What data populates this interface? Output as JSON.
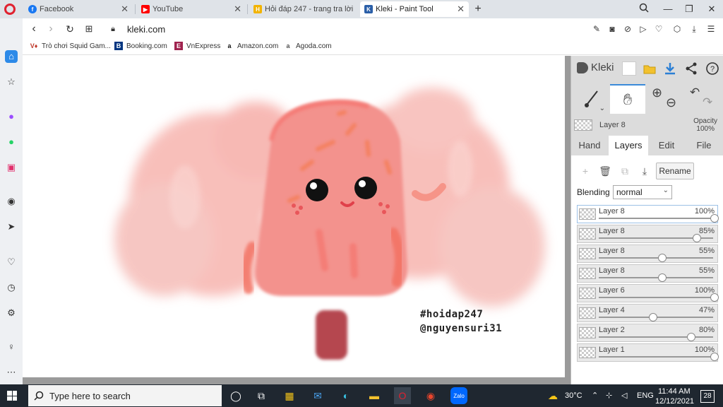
{
  "browser": {
    "tabs": [
      {
        "label": "Facebook",
        "favicon_color": "#1877f2",
        "favicon_text": "f"
      },
      {
        "label": "YouTube",
        "favicon_color": "#ff0000",
        "favicon_text": "▶"
      },
      {
        "label": "Hỏi đáp 247 - trang tra lời",
        "favicon_color": "#f2b300",
        "favicon_text": "H"
      },
      {
        "label": "Kleki - Paint Tool",
        "favicon_color": "#2b5fa8",
        "favicon_text": "K"
      }
    ],
    "new_tab": "+",
    "url": "kleki.com",
    "bookmarks": [
      {
        "label": "Trò chơi Squid Gam...",
        "icon": "V♦",
        "icon_color": "#c0392b"
      },
      {
        "label": "Booking.com",
        "icon": "B",
        "icon_color": "#003580"
      },
      {
        "label": "VnExpress",
        "icon": "E",
        "icon_color": "#9f224e"
      },
      {
        "label": "Amazon.com",
        "icon": "a",
        "icon_color": "#111"
      },
      {
        "label": "Agoda.com",
        "icon": "a",
        "icon_color": "#555"
      }
    ]
  },
  "canvas": {
    "watermark_line1": "#hoidap247",
    "watermark_line2": "@nguyensuri31"
  },
  "kleki": {
    "logo": "Kleki",
    "current_layer": {
      "name": "Layer 8",
      "opacity_label": "Opacity",
      "opacity_value": "100%"
    },
    "tabs": [
      "Hand",
      "Layers",
      "Edit",
      "File"
    ],
    "active_tab": "Layers",
    "rename_label": "Rename",
    "blending_label": "Blending",
    "blending_value": "normal",
    "layers": [
      {
        "name": "Layer 8",
        "opacity": "100%",
        "value": 1.0,
        "selected": true
      },
      {
        "name": "Layer 8",
        "opacity": "85%",
        "value": 0.85,
        "selected": false
      },
      {
        "name": "Layer 8",
        "opacity": "55%",
        "value": 0.55,
        "selected": false
      },
      {
        "name": "Layer 8",
        "opacity": "55%",
        "value": 0.55,
        "selected": false
      },
      {
        "name": "Layer 6",
        "opacity": "100%",
        "value": 1.0,
        "selected": false
      },
      {
        "name": "Layer 4",
        "opacity": "47%",
        "value": 0.47,
        "selected": false
      },
      {
        "name": "Layer 2",
        "opacity": "80%",
        "value": 0.8,
        "selected": false
      },
      {
        "name": "Layer 1",
        "opacity": "100%",
        "value": 1.0,
        "selected": false
      }
    ]
  },
  "taskbar": {
    "search_placeholder": "Type here to search",
    "temperature": "30°C",
    "language": "ENG",
    "time": "11:44 AM",
    "date": "12/12/2021",
    "notification_count": "28"
  }
}
